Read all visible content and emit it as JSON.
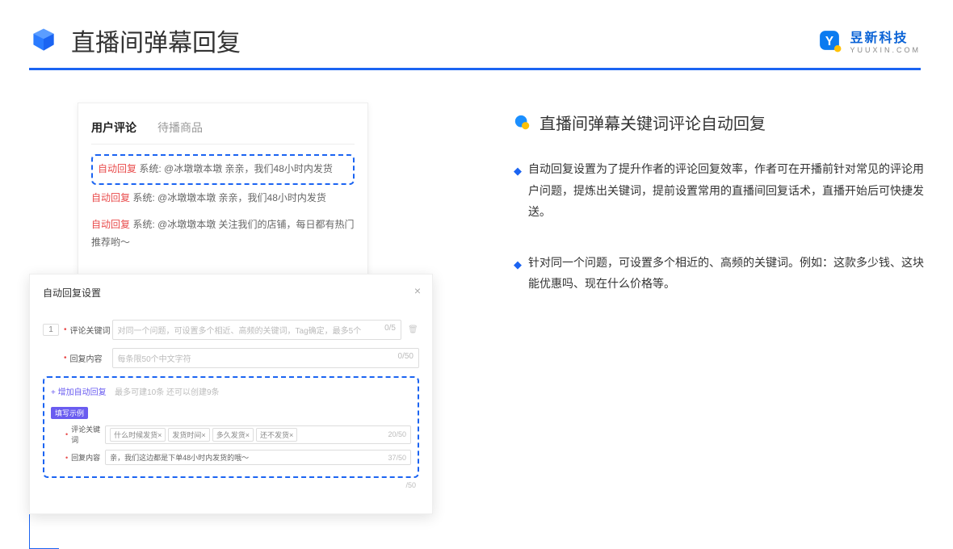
{
  "header": {
    "title": "直播间弹幕回复",
    "logo_main": "昱新科技",
    "logo_sub": "YUUXIN.COM"
  },
  "comment_panel": {
    "tabs": [
      "用户评论",
      "待播商品"
    ],
    "items": [
      {
        "label": "自动回复",
        "text": "系统: @冰墩墩本墩 亲亲，我们48小时内发货"
      },
      {
        "label": "自动回复",
        "text": "系统: @冰墩墩本墩 亲亲，我们48小时内发货"
      },
      {
        "label": "自动回复",
        "text": "系统: @冰墩墩本墩 关注我们的店铺，每日都有热门推荐哟～"
      }
    ]
  },
  "settings": {
    "title": "自动回复设置",
    "index": "1",
    "kw_label": "评论关键词",
    "kw_placeholder": "对同一个问题，可设置多个相近、高频的关键词，Tag确定，最多5个",
    "kw_counter": "0/5",
    "content_label": "回复内容",
    "content_placeholder": "每条限50个中文字符",
    "content_counter": "0/50",
    "add_link": "+ 增加自动回复",
    "add_note": "最多可建10条 还可以创建9条",
    "badge": "填写示例",
    "ex_kw_label": "评论关键词",
    "ex_tags": [
      "什么时候发货×",
      "发货时间×",
      "多久发货×",
      "还不发货×"
    ],
    "ex_kw_counter": "20/50",
    "ex_content_label": "回复内容",
    "ex_content_text": "亲，我们这边都是下单48小时内发货的哦～",
    "ex_content_counter": "37/50",
    "extra_counter": "/50"
  },
  "right": {
    "section_title": "直播间弹幕关键词评论自动回复",
    "bullets": [
      "自动回复设置为了提升作者的评论回复效率，作者可在开播前针对常见的评论用户问题，提炼出关键词，提前设置常用的直播间回复话术，直播开始后可快捷发送。",
      "针对同一个问题，可设置多个相近的、高频的关键词。例如：这款多少钱、这块能优惠吗、现在什么价格等。"
    ]
  }
}
